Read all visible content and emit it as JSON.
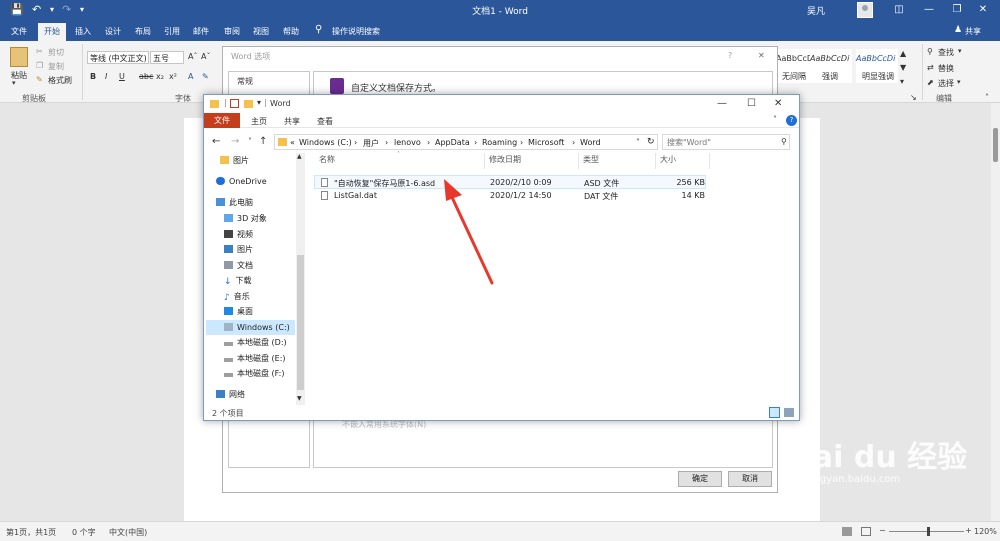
{
  "word": {
    "title": "文档1 - Word",
    "user": "吴凡",
    "share": "共享",
    "tabs": [
      "文件",
      "开始",
      "插入",
      "设计",
      "布局",
      "引用",
      "邮件",
      "审阅",
      "视图",
      "帮助"
    ],
    "tell_me": "操作说明搜索",
    "clipboard": {
      "paste": "粘贴",
      "cut": "剪切",
      "copy": "复制",
      "format_painter": "格式刷",
      "group": "剪贴板"
    },
    "font": {
      "name": "等线 (中文正文)",
      "size": "五号",
      "group": "字体"
    },
    "styles": [
      {
        "sample": "AaBbCcDi",
        "label": "无间隔"
      },
      {
        "sample": "AaBbCcDi",
        "label": "强调"
      },
      {
        "sample": "AaBbCcDi",
        "label": "明显强调"
      }
    ],
    "editing": {
      "find": "查找",
      "replace": "替换",
      "select": "选择",
      "group": "编辑"
    },
    "statusbar": {
      "page": "第1页，共1页",
      "words": "0 个字",
      "lang": "中文(中国)",
      "zoom": "120%"
    }
  },
  "options_dialog": {
    "title": "Word 选项",
    "help": "?",
    "close": "✕",
    "nav_first": "常规",
    "header": "自定义文档保存方式。",
    "hidden_option": "不嵌入常用系统字体(N)",
    "ok": "确定",
    "cancel": "取消"
  },
  "explorer": {
    "title": "Word",
    "ribbon_tabs": [
      "文件",
      "主页",
      "共享",
      "查看"
    ],
    "address": [
      "Windows (C:)",
      "用户",
      "lenovo",
      "AppData",
      "Roaming",
      "Microsoft",
      "Word"
    ],
    "address_prefix": "«",
    "search_placeholder": "搜索\"Word\"",
    "nav": [
      {
        "label": "图片",
        "icon": "folder-icon"
      },
      {
        "label": "OneDrive",
        "icon": "cloud-icon"
      },
      {
        "label": "此电脑",
        "icon": "computer-icon"
      },
      {
        "label": "3D 对象",
        "icon": "cube-icon"
      },
      {
        "label": "视频",
        "icon": "video-icon"
      },
      {
        "label": "图片",
        "icon": "picture-icon"
      },
      {
        "label": "文档",
        "icon": "document-icon"
      },
      {
        "label": "下载",
        "icon": "download-icon"
      },
      {
        "label": "音乐",
        "icon": "music-icon"
      },
      {
        "label": "桌面",
        "icon": "desktop-icon"
      },
      {
        "label": "Windows (C:)",
        "icon": "drive-icon"
      },
      {
        "label": "本地磁盘 (D:)",
        "icon": "drive-icon"
      },
      {
        "label": "本地磁盘 (E:)",
        "icon": "drive-icon"
      },
      {
        "label": "本地磁盘 (F:)",
        "icon": "drive-icon"
      },
      {
        "label": "网络",
        "icon": "network-icon"
      }
    ],
    "columns": [
      "名称",
      "修改日期",
      "类型",
      "大小"
    ],
    "files": [
      {
        "name": "\"自动恢复\"保存马原1-6.asd",
        "date": "2020/2/10 0:09",
        "type": "ASD 文件",
        "size": "256 KB"
      },
      {
        "name": "ListGal.dat",
        "date": "2020/1/2 14:50",
        "type": "DAT 文件",
        "size": "14 KB"
      }
    ],
    "item_count": "2 个项目"
  },
  "watermark": {
    "brand": "Bai du 经验",
    "url": "jingyan.baidu.com"
  },
  "colors": {
    "word_blue": "#2b579a",
    "file_tab_red": "#c43e1c",
    "annotation_red": "#e8382c",
    "selection_blue": "#cce8ff"
  }
}
